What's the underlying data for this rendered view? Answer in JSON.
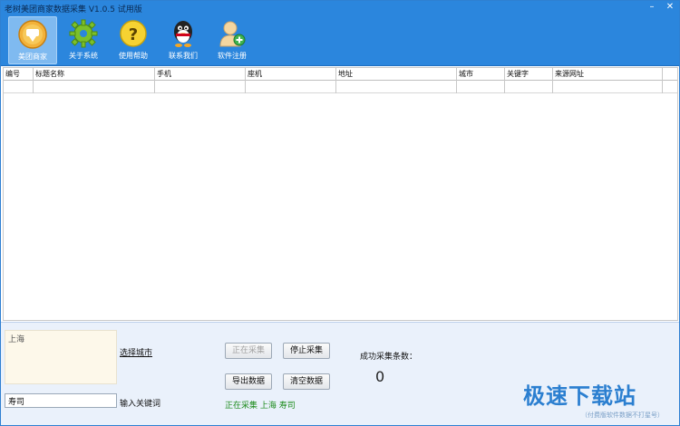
{
  "window": {
    "title": "老树美团商家数据采集 V1.0.5 试用版",
    "controls": {
      "minimize": "–",
      "close": "✕"
    }
  },
  "toolbar": {
    "items": [
      {
        "label": "美团商家",
        "icon": "meituan-store-icon",
        "active": true
      },
      {
        "label": "关于系统",
        "icon": "gear-icon",
        "active": false
      },
      {
        "label": "使用帮助",
        "icon": "help-icon",
        "active": false
      },
      {
        "label": "联系我们",
        "icon": "qq-penguin-icon",
        "active": false
      },
      {
        "label": "软件注册",
        "icon": "user-register-icon",
        "active": false
      }
    ]
  },
  "table": {
    "columns": [
      "编号",
      "标题名称",
      "手机",
      "座机",
      "地址",
      "城市",
      "关键字",
      "来源网址"
    ],
    "rows": [
      [
        "",
        "",
        "",
        "",
        "",
        "",
        "",
        ""
      ]
    ]
  },
  "controls": {
    "city_value": "上海",
    "select_city_label": "选择城市",
    "keyword_value": "寿司",
    "keyword_label": "输入关键词",
    "start_button": "正在采集",
    "stop_button": "停止采集",
    "export_button": "导出数据",
    "clear_button": "清空数据",
    "status_text": "正在采集 上海 寿司",
    "success_label": "成功采集条数：",
    "success_count": "0"
  },
  "watermark": {
    "brand": "极速下载站",
    "sub": "（付费版软件数据不打星号）"
  },
  "colors": {
    "titlebar": "#2b86dd",
    "status_green": "#1a8a1a",
    "brand_blue": "#2b7fd0"
  }
}
